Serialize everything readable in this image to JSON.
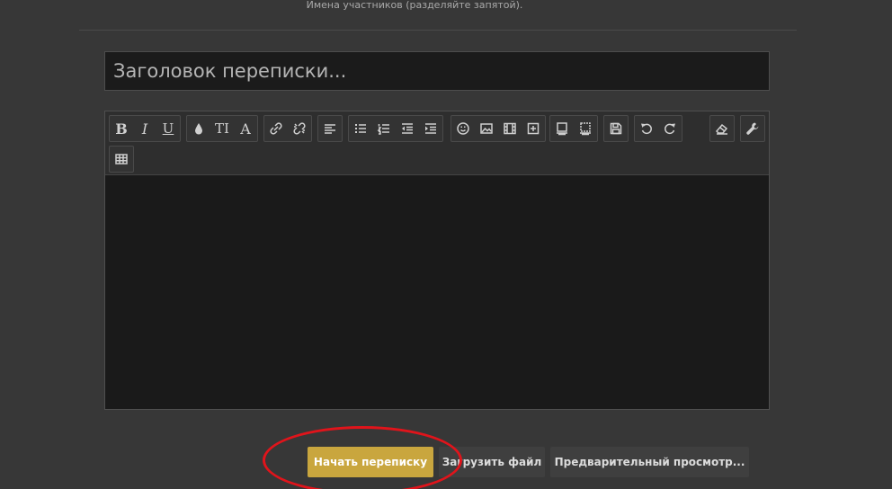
{
  "participants": {
    "hint": "Имена участников (разделяйте запятой)."
  },
  "title_field": {
    "placeholder": "Заголовок переписки..."
  },
  "toolbar": {
    "bold": "B",
    "italic": "I",
    "underline": "U",
    "font_size": "TI",
    "font_family": "A"
  },
  "actions": {
    "start": "Начать переписку",
    "upload": "Загрузить файл",
    "preview": "Предварительный просмотр..."
  },
  "colors": {
    "accent": "#c9a63e",
    "highlight": "#e0141b",
    "background": "#373737"
  }
}
